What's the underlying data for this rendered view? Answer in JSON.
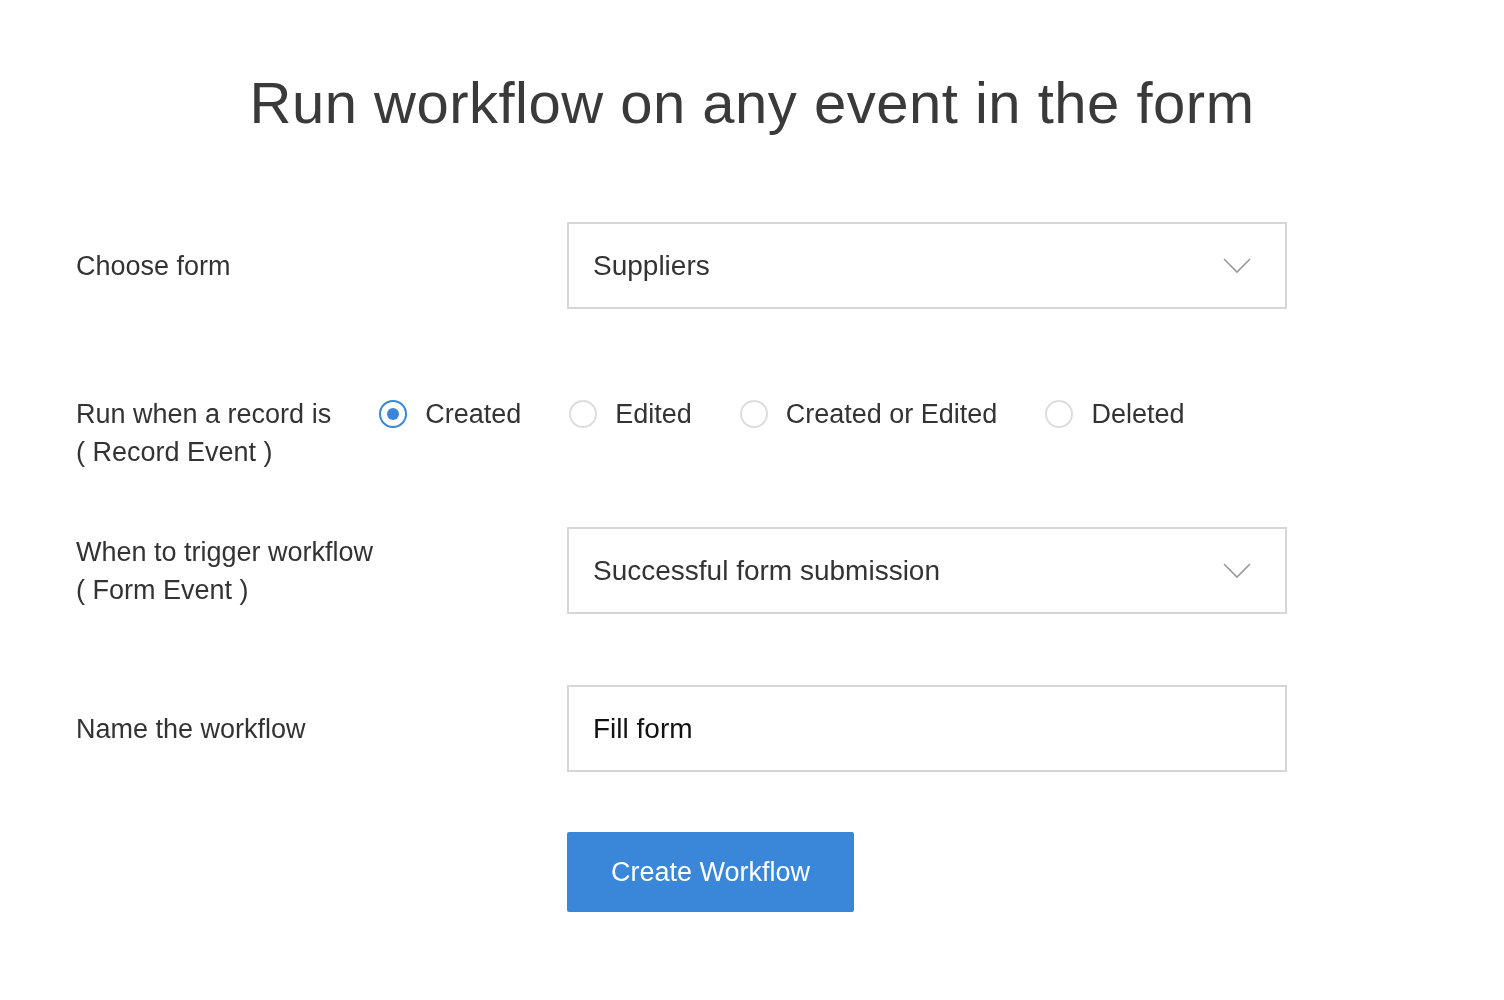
{
  "title": "Run workflow on any event in the form",
  "rows": [
    {
      "kind": "select",
      "label": "Choose form",
      "value": "Suppliers"
    },
    {
      "kind": "radios",
      "label": "Run when a record is",
      "sublabel": "( Record Event )",
      "options": [
        {
          "label": "Created",
          "selected": true
        },
        {
          "label": "Edited",
          "selected": false
        },
        {
          "label": "Created or Edited",
          "selected": false
        },
        {
          "label": "Deleted",
          "selected": false
        }
      ]
    },
    {
      "kind": "select",
      "label": "When to trigger workflow",
      "sublabel": "( Form Event )",
      "value": "Successful form submission"
    },
    {
      "kind": "text",
      "label": "Name the workflow",
      "value": "Fill form"
    }
  ],
  "button": "Create Workflow"
}
